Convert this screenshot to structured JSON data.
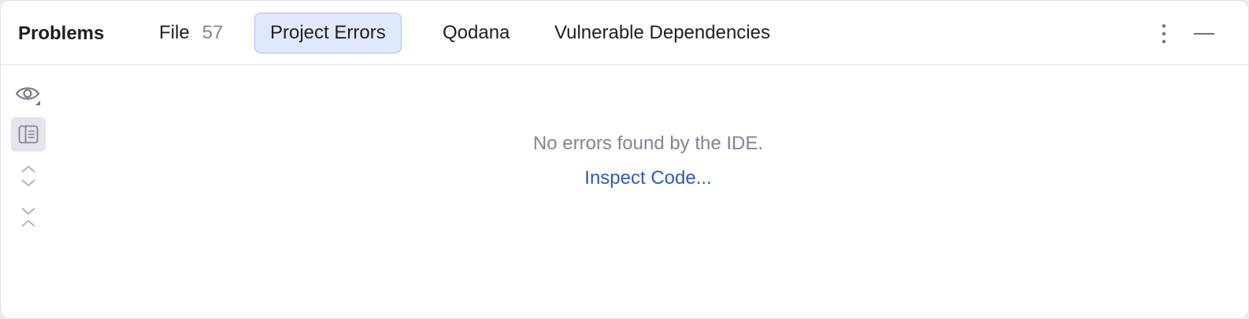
{
  "header": {
    "title": "Problems",
    "tabs": [
      {
        "label": "File",
        "count": "57",
        "selected": false
      },
      {
        "label": "Project Errors",
        "selected": true
      },
      {
        "label": "Qodana",
        "selected": false
      },
      {
        "label": "Vulnerable Dependencies",
        "selected": false
      }
    ],
    "icons": [
      "more-options-icon",
      "minimize-icon"
    ]
  },
  "toolbar": {
    "items": [
      "eye-icon",
      "preview-panel-icon",
      "expand-all-icon",
      "collapse-all-icon"
    ]
  },
  "empty_state": {
    "message": "No errors found by the IDE.",
    "action_label": "Inspect Code..."
  },
  "colors": {
    "selected_tab_bg": "#dfe9fd",
    "selected_tab_border": "#a9c0f5",
    "link": "#2f5cb6",
    "muted_text": "#818594"
  }
}
